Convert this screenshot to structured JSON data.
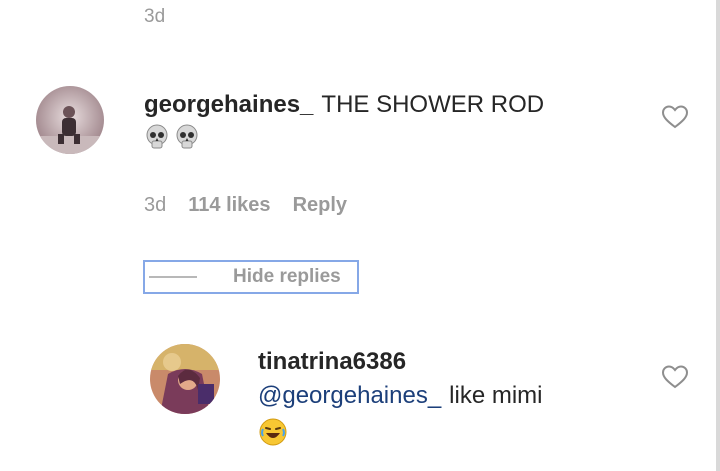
{
  "top": {
    "timestamp": "3d"
  },
  "comments": [
    {
      "username": "georgehaines_",
      "text": "THE SHOWER ROD",
      "emoji": [
        "skull",
        "skull"
      ],
      "timestamp": "3d",
      "likes": "114 likes",
      "reply_label": "Reply",
      "avatar_icon": "user-photo-avatar"
    }
  ],
  "replies_toggle": {
    "label": "Hide replies"
  },
  "replies": [
    {
      "username": "tinatrina6386",
      "mention": "@georgehaines_",
      "text": "like mimi",
      "emoji": [
        "laughing-face"
      ],
      "avatar_icon": "user-photo-avatar"
    }
  ],
  "icons": {
    "like": "heart-outline-icon"
  },
  "colors": {
    "text": "#262626",
    "meta": "#9a9a9a",
    "mention": "#1c3f7a",
    "focus_outline": "#86a8e7"
  }
}
